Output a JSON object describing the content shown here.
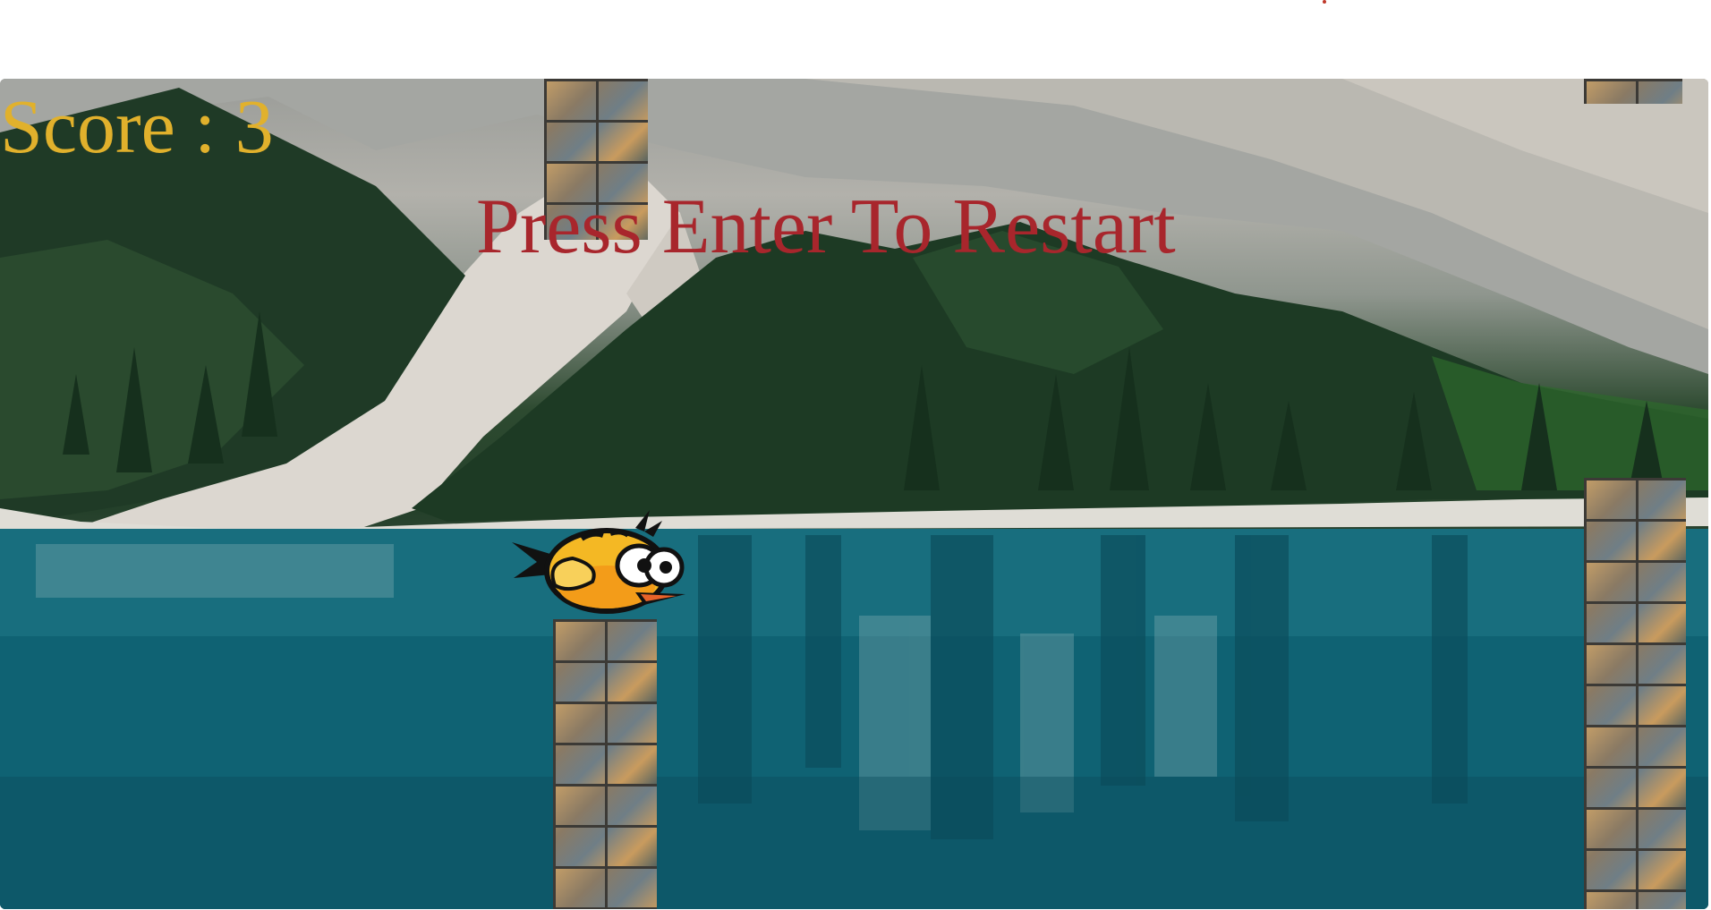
{
  "hud": {
    "score_text": "Score : 3",
    "restart_text": "Press Enter To Restart"
  },
  "scene": {
    "background": "mountain lake with pine forest",
    "player": "bird-icon",
    "obstacle": "stone-pillar"
  },
  "colors": {
    "score": "#e1b12c",
    "restart": "#a8262c",
    "bird_body": "#f4b824",
    "water": "#0e6878"
  }
}
